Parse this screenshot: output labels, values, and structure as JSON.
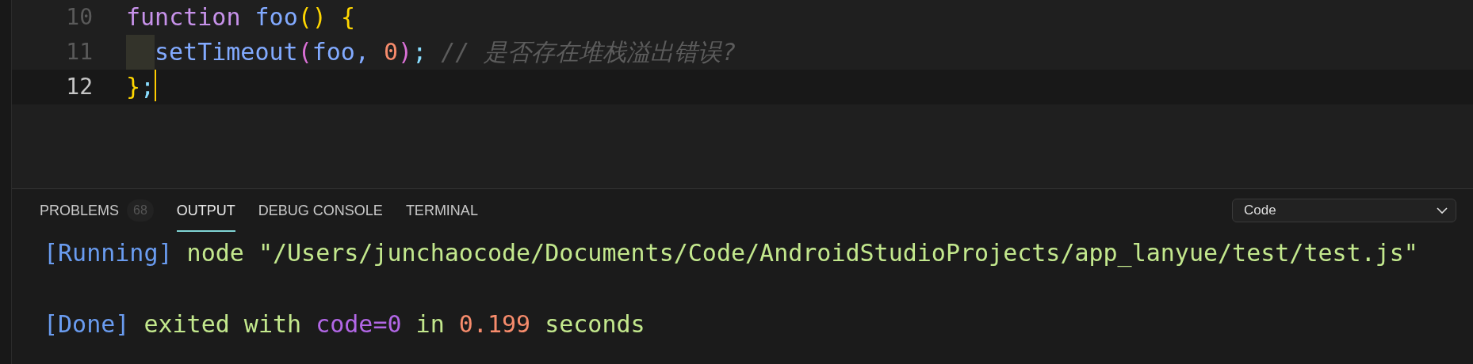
{
  "editor": {
    "lines": [
      {
        "number": "10",
        "current": false,
        "indent_guide": false,
        "tokens": [
          {
            "text": "function ",
            "kind": "keyword"
          },
          {
            "text": "foo",
            "kind": "function"
          },
          {
            "text": "()",
            "kind": "paren"
          },
          {
            "text": " {",
            "kind": "brace"
          }
        ]
      },
      {
        "number": "11",
        "current": false,
        "indent_guide": true,
        "tokens": [
          {
            "text": "setTimeout",
            "kind": "function"
          },
          {
            "text": "(",
            "kind": "paren2"
          },
          {
            "text": "foo, ",
            "kind": "function"
          },
          {
            "text": "0",
            "kind": "number"
          },
          {
            "text": ")",
            "kind": "paren2"
          },
          {
            "text": ";",
            "kind": "punct"
          },
          {
            "text": " // 是否存在堆栈溢出错误?",
            "kind": "comment"
          }
        ]
      },
      {
        "number": "12",
        "current": true,
        "indent_guide": false,
        "tokens": [
          {
            "text": "}",
            "kind": "brace"
          },
          {
            "text": ";",
            "kind": "punct"
          }
        ]
      }
    ]
  },
  "panel": {
    "tabs": [
      {
        "label": "PROBLEMS",
        "badge": "68",
        "selected": false
      },
      {
        "label": "OUTPUT",
        "selected": true
      },
      {
        "label": "DEBUG CONSOLE",
        "selected": false
      },
      {
        "label": "TERMINAL",
        "selected": false
      }
    ],
    "channel_select": {
      "value": "Code"
    },
    "output": [
      [
        {
          "text": "[Running]",
          "kind": "tag"
        },
        {
          "text": " node \"/Users/junchaocode/Documents/Code/AndroidStudioProjects/app_lanyue/test/test.js\"",
          "kind": "text"
        }
      ],
      [
        {
          "text": "[Done]",
          "kind": "tag"
        },
        {
          "text": " exited with ",
          "kind": "text"
        },
        {
          "text": "code=0",
          "kind": "keyword"
        },
        {
          "text": " in ",
          "kind": "text"
        },
        {
          "text": "0.199",
          "kind": "number"
        },
        {
          "text": " seconds",
          "kind": "text"
        }
      ]
    ]
  }
}
